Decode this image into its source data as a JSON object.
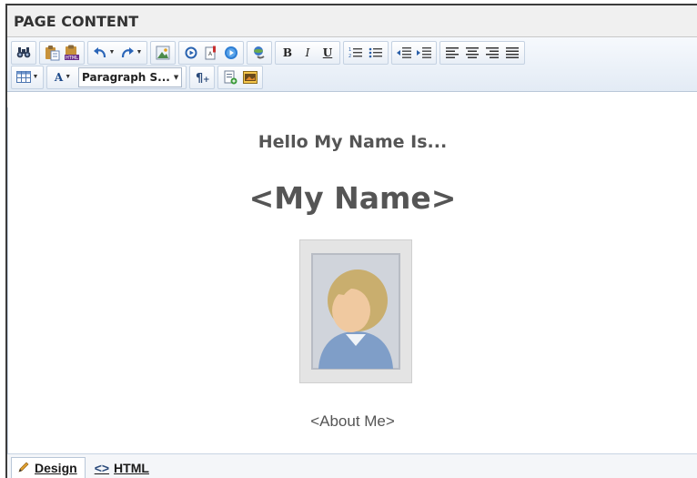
{
  "header": {
    "title": "PAGE CONTENT"
  },
  "toolbar": {
    "row1": [
      {
        "name": "find-replace-icon",
        "glyph": "find"
      },
      {
        "name": "paste-icon",
        "glyph": "paste"
      },
      {
        "name": "paste-html-icon",
        "glyph": "paste-html"
      },
      {
        "name": "undo-icon",
        "glyph": "undo"
      },
      {
        "name": "redo-icon",
        "glyph": "redo"
      },
      {
        "name": "image-manager-icon",
        "glyph": "image"
      },
      {
        "name": "media-manager-icon",
        "glyph": "media"
      },
      {
        "name": "document-manager-icon",
        "glyph": "document"
      },
      {
        "name": "flash-manager-icon",
        "glyph": "flash"
      },
      {
        "name": "hyperlink-icon",
        "glyph": "link"
      }
    ],
    "bold_label": "B",
    "italic_label": "I",
    "underline_label": "U",
    "paragraph_style": "Paragraph S...",
    "font_color_label": "A"
  },
  "content": {
    "heading_small": "Hello My Name Is...",
    "heading_large": "<My Name>",
    "about": "<About Me>"
  },
  "footer": {
    "design_tab": "Design",
    "html_tab": "HTML"
  },
  "colors": {
    "toolbar_bg_top": "#f6f9fd",
    "toolbar_bg_bottom": "#e3ebf5",
    "accent_blue": "#1b6ec2"
  }
}
